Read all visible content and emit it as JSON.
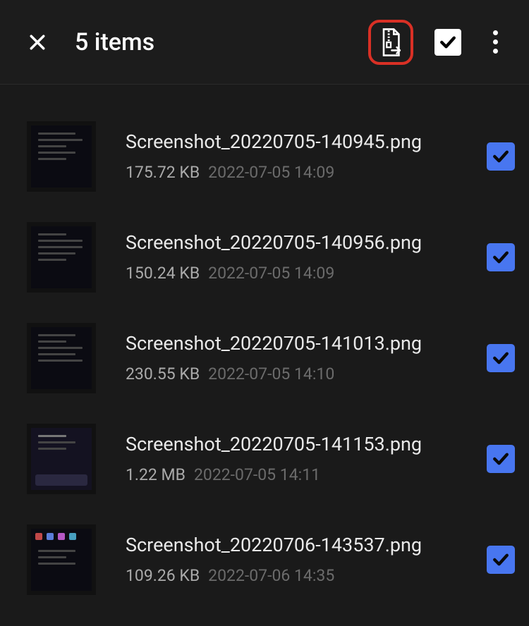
{
  "header": {
    "title": "5 items"
  },
  "files": [
    {
      "name": "Screenshot_20220705-140945.png",
      "size": "175.72 KB",
      "date": "2022-07-05 14:09",
      "selected": true
    },
    {
      "name": "Screenshot_20220705-140956.png",
      "size": "150.24 KB",
      "date": "2022-07-05 14:09",
      "selected": true
    },
    {
      "name": "Screenshot_20220705-141013.png",
      "size": "230.55 KB",
      "date": "2022-07-05 14:10",
      "selected": true
    },
    {
      "name": "Screenshot_20220705-141153.png",
      "size": "1.22 MB",
      "date": "2022-07-05 14:11",
      "selected": true
    },
    {
      "name": "Screenshot_20220706-143537.png",
      "size": "109.26 KB",
      "date": "2022-07-06 14:35",
      "selected": true
    }
  ],
  "colors": {
    "accent": "#4876f0",
    "highlight": "#d93025"
  }
}
